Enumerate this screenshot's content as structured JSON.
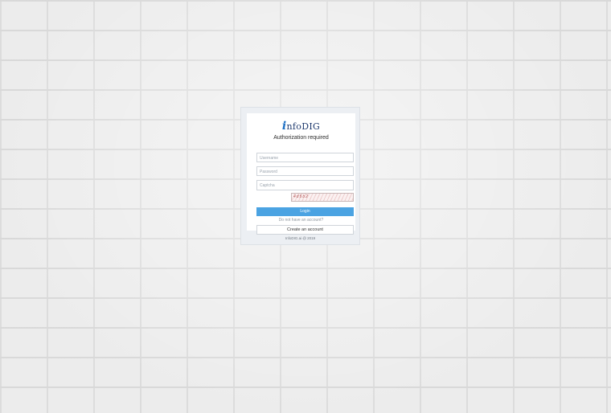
{
  "brand": {
    "logo_mark": "i",
    "logo_text": "nfoDIG"
  },
  "form": {
    "title": "Authorization required",
    "username_placeholder": "Username",
    "password_placeholder": "Password",
    "captcha_placeholder": "Captcha",
    "captcha_image_text": "4d5b2",
    "login_label": "Login",
    "no_account_text": "Do not have an account?",
    "create_label": "Create an account"
  },
  "footer": {
    "text": "InfoDIG.ai @ 2019"
  },
  "colors": {
    "accent": "#4ba3e2",
    "brand": "#1c6fc4"
  }
}
